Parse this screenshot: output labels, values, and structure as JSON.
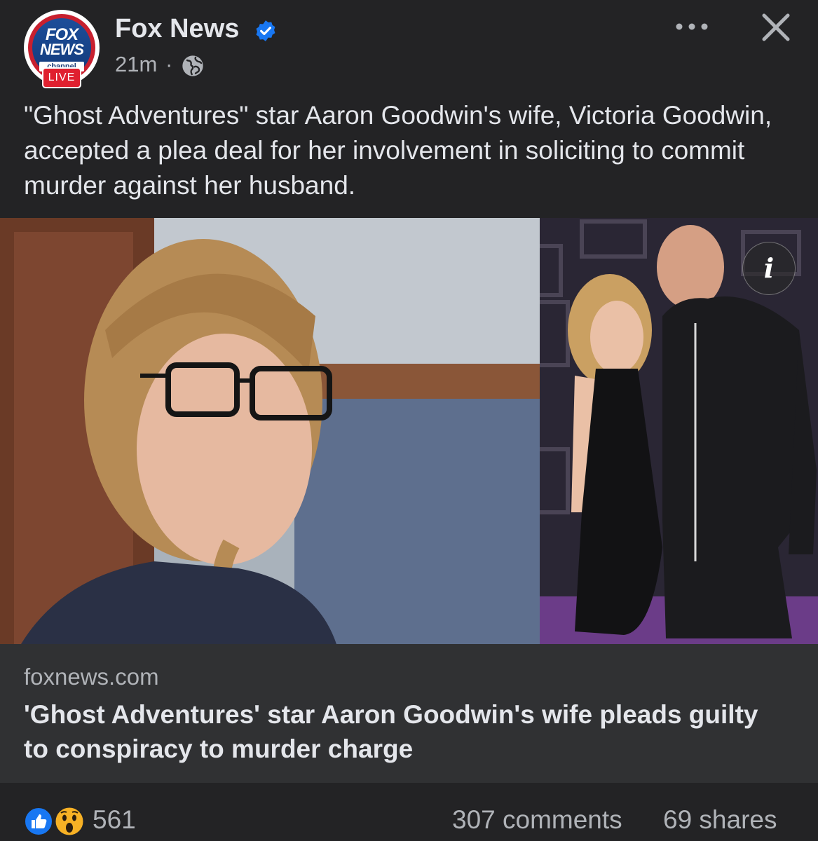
{
  "post": {
    "page_name": "Fox News",
    "time": "21m",
    "separator": "·",
    "caption": "\"Ghost Adventures\" star Aaron Goodwin's wife, Victoria Goodwin, accepted a plea deal for her involvement in soliciting to commit murder against her husband."
  },
  "avatar": {
    "logo_line1": "FOX",
    "logo_line2": "NEWS",
    "logo_line3": "channel",
    "live_badge": "LIVE"
  },
  "icons": {
    "verified": "verified-badge-icon",
    "audience": "globe-icon",
    "more": "more-options-icon",
    "close": "close-icon",
    "info": "info-icon",
    "reaction_like": "like-reaction-icon",
    "reaction_wow": "wow-reaction-icon"
  },
  "info_glyph": "i",
  "link_preview": {
    "domain": "foxnews.com",
    "title": "'Ghost Adventures' star Aaron Goodwin's wife pleads guilty to conspiracy to murder charge"
  },
  "stats": {
    "reactions": "561",
    "comments": "307 comments",
    "shares": "69 shares"
  },
  "colors": {
    "background": "#232325",
    "link_box": "#303133",
    "verified": "#1877f2",
    "live_red": "#e0202f"
  }
}
